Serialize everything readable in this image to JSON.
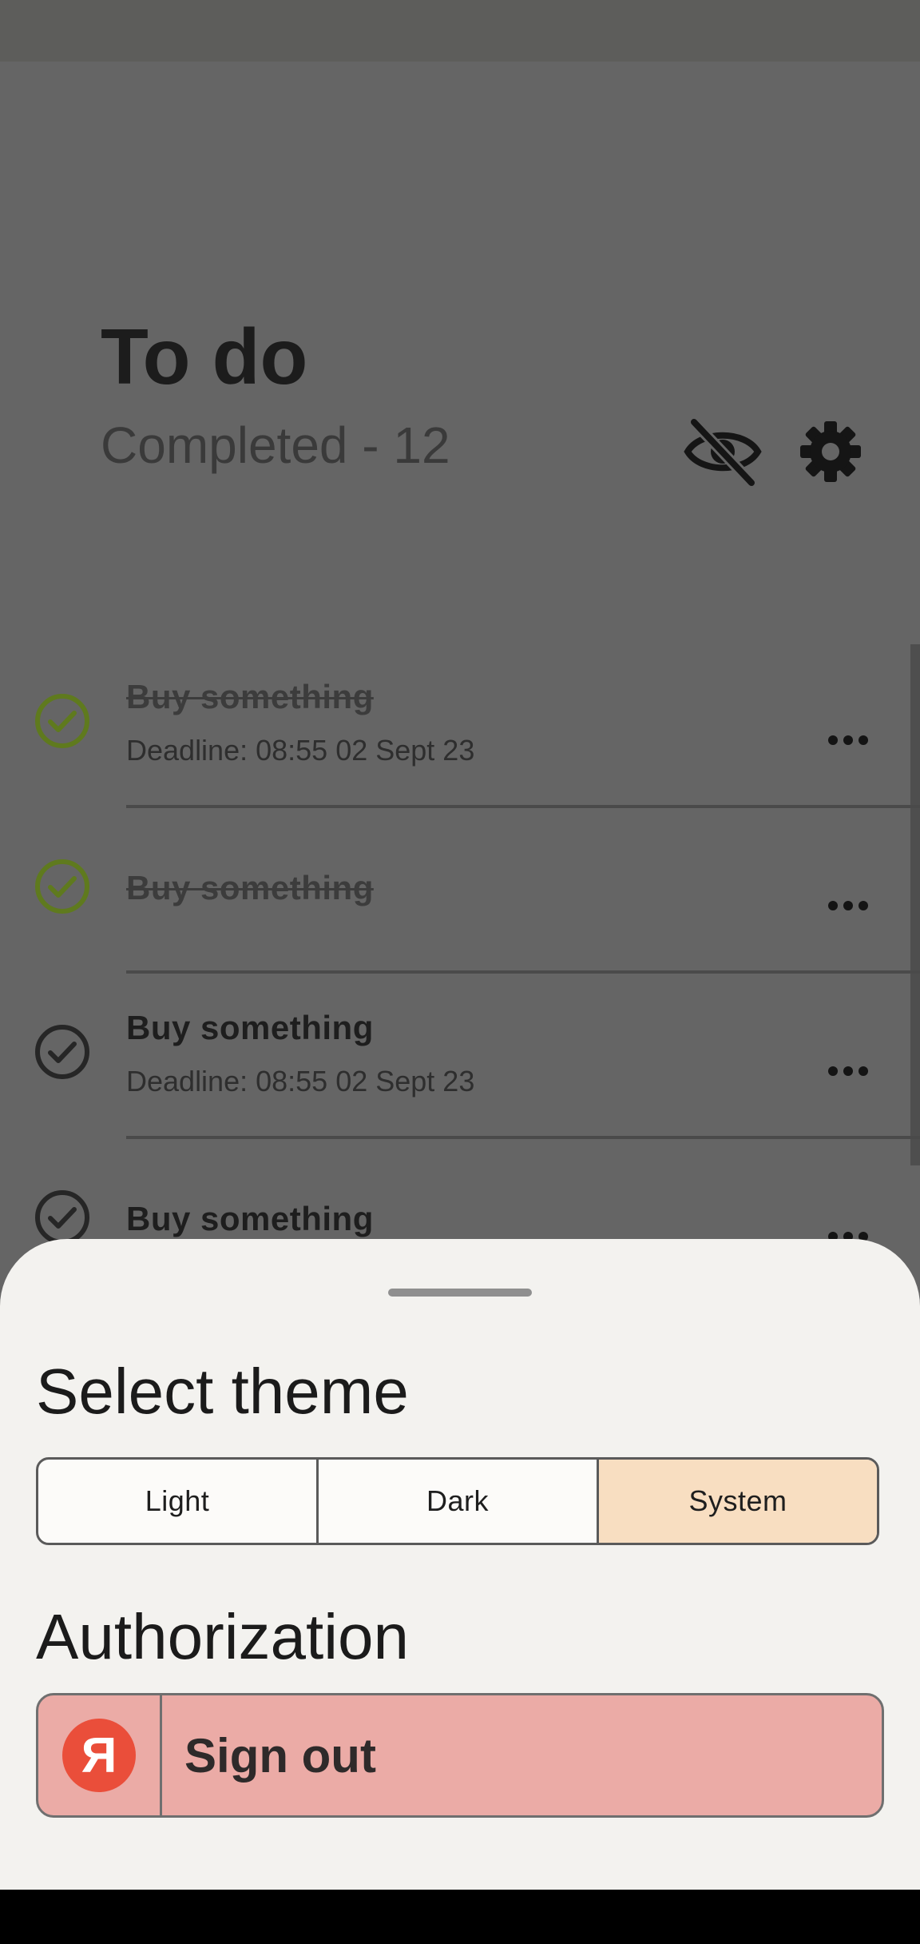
{
  "header": {
    "title": "To do",
    "completed_text": "Completed - 12",
    "visibility_icon": "eye-off-icon",
    "settings_icon": "gear-icon"
  },
  "tasks": [
    {
      "title": "Buy something",
      "deadline": "Deadline: 08:55 02 Sept 23",
      "completed": true
    },
    {
      "title": "Buy something",
      "deadline": "",
      "completed": true
    },
    {
      "title": "Buy something",
      "deadline": "Deadline: 08:55 02 Sept 23",
      "completed": false
    },
    {
      "title": "Buy something",
      "deadline": "",
      "completed": false
    }
  ],
  "sheet": {
    "theme_title": "Select theme",
    "theme_options": [
      "Light",
      "Dark",
      "System"
    ],
    "theme_selected": "System",
    "auth_title": "Authorization",
    "sign_out_label": "Sign out",
    "yandex_logo_letter": "Я"
  },
  "colors": {
    "scrim": "#656565",
    "sheet_bg": "#f3f2ef",
    "selected_segment": "#f8dec1",
    "sign_out_bg": "#ebaba6",
    "yandex_red": "#ea4e3a",
    "done_check": "#5f7a1e"
  }
}
